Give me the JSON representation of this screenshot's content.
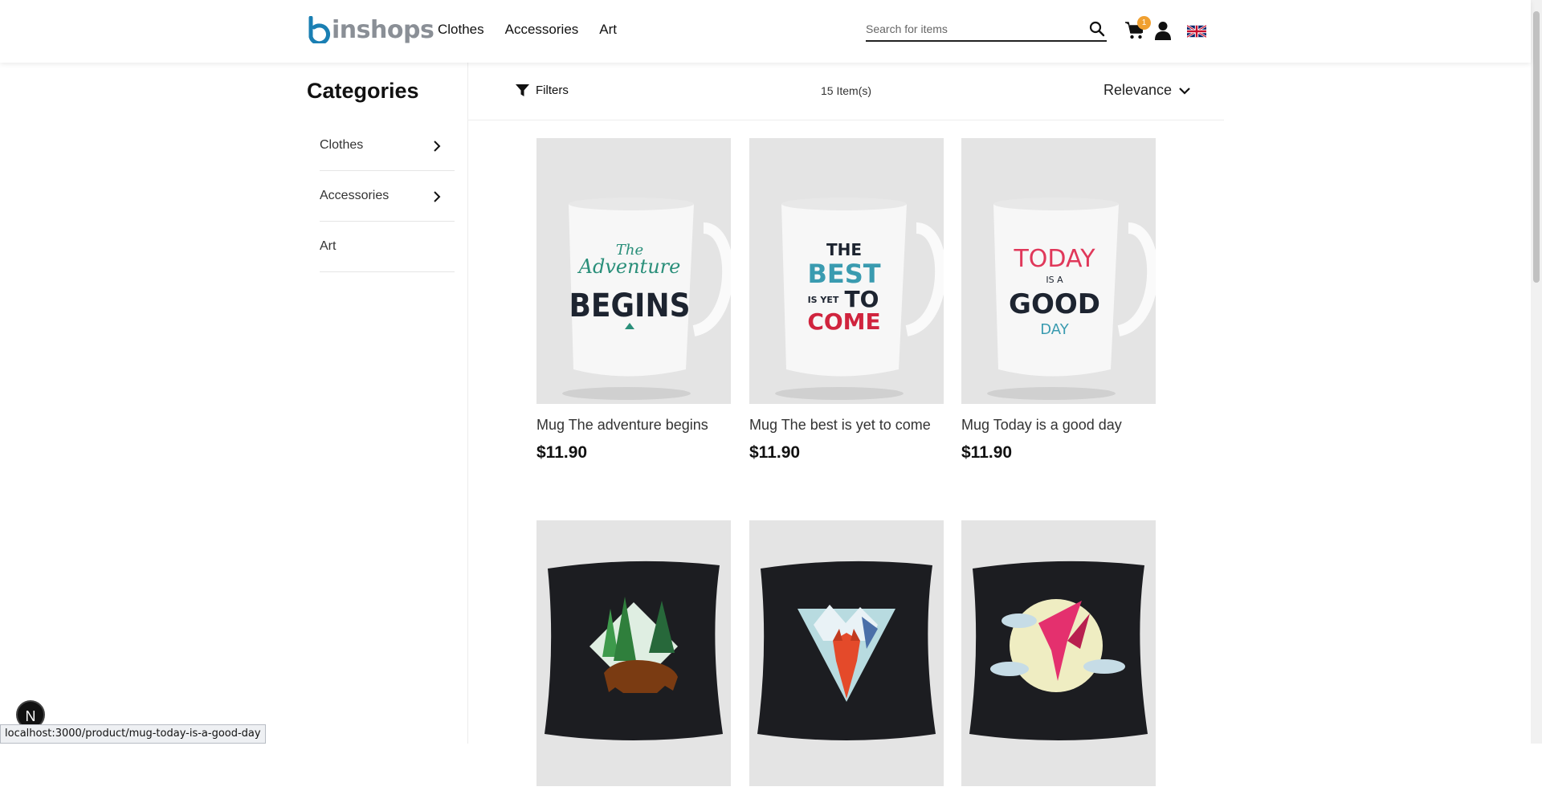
{
  "header": {
    "logo_text": "inshops",
    "nav": [
      "Clothes",
      "Accessories",
      "Art"
    ],
    "search_placeholder": "Search for items",
    "cart_count": "1"
  },
  "sidebar": {
    "title": "Categories",
    "items": [
      {
        "label": "Clothes",
        "has_children": true
      },
      {
        "label": "Accessories",
        "has_children": true
      },
      {
        "label": "Art",
        "has_children": false
      }
    ]
  },
  "toolbar": {
    "filters_label": "Filters",
    "items_count": "15 Item(s)",
    "sort_label": "Relevance"
  },
  "products": [
    {
      "name": "Mug The adventure begins",
      "price": "$11.90"
    },
    {
      "name": "Mug The best is yet to come",
      "price": "$11.90"
    },
    {
      "name": "Mug Today is a good day",
      "price": "$11.90"
    },
    {
      "name": "",
      "price": ""
    },
    {
      "name": "",
      "price": ""
    },
    {
      "name": "",
      "price": ""
    }
  ],
  "product_mug_text": {
    "mug1": [
      "The",
      "Adventure",
      "BEGINS"
    ],
    "mug2": [
      "THE",
      "BEST",
      "IS YET",
      "TO",
      "COME"
    ],
    "mug3": [
      "TODAY",
      "IS A",
      "GOOD",
      "DAY"
    ]
  },
  "status_url": "localhost:3000/product/mug-today-is-a-good-day",
  "next_badge": "N",
  "colors": {
    "brand_blue": "#1a7fb3",
    "cart_badge": "#f0a030",
    "product_bg": "#e4e4e4",
    "pillow": "#1c1d21"
  }
}
